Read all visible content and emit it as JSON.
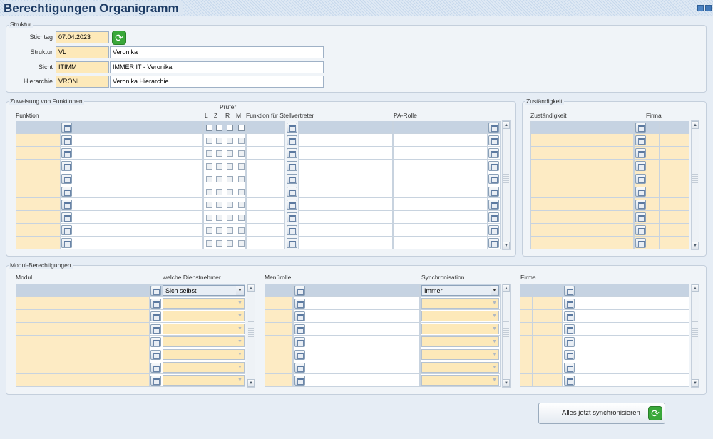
{
  "window": {
    "title": "Berechtigungen Organigramm",
    "minimize_icon": "minimize-icon",
    "close_icon": "close-icon"
  },
  "struktur": {
    "legend": "Struktur",
    "stichtag_label": "Stichtag",
    "stichtag_value": "07.04.2023",
    "struktur_label": "Struktur",
    "struktur_code": "VL",
    "struktur_name": "Veronika",
    "sicht_label": "Sicht",
    "sicht_code": "ITIMM",
    "sicht_name": "IMMER IT - Veronika",
    "hierarchie_label": "Hierarchie",
    "hierarchie_code": "VRONI",
    "hierarchie_name": "Veronika Hierarchie"
  },
  "zuweisung": {
    "legend": "Zuweisung von Funktionen",
    "col_funktion": "Funktion",
    "col_pruefer": "Prüfer",
    "col_l": "L",
    "col_z": "Z",
    "col_r": "R",
    "col_m": "M",
    "col_stellvertreter": "Funktion für Stellvertreter",
    "col_parolle": "PA-Rolle",
    "row_count": 10
  },
  "zustaendigkeit": {
    "legend": "Zuständigkeit",
    "col_zustaendigkeit": "Zuständigkeit",
    "col_firma": "Firma",
    "row_count": 10
  },
  "modul": {
    "legend": "Modul-Berechtigungen",
    "col_modul": "Modul",
    "col_dienstnehmer": "welche Dienstnehmer",
    "first_dienstnehmer": "Sich selbst",
    "col_menuerolle": "Menürolle",
    "col_sync": "Synchronisation",
    "first_sync": "Immer",
    "col_firma": "Firma",
    "row_count": 8
  },
  "actions": {
    "sync_all_label": "Alles jetzt synchronisieren"
  },
  "colors": {
    "key_field": "#fde9b9",
    "selected_row": "#c6d3e2",
    "title": "#1c3a63"
  }
}
